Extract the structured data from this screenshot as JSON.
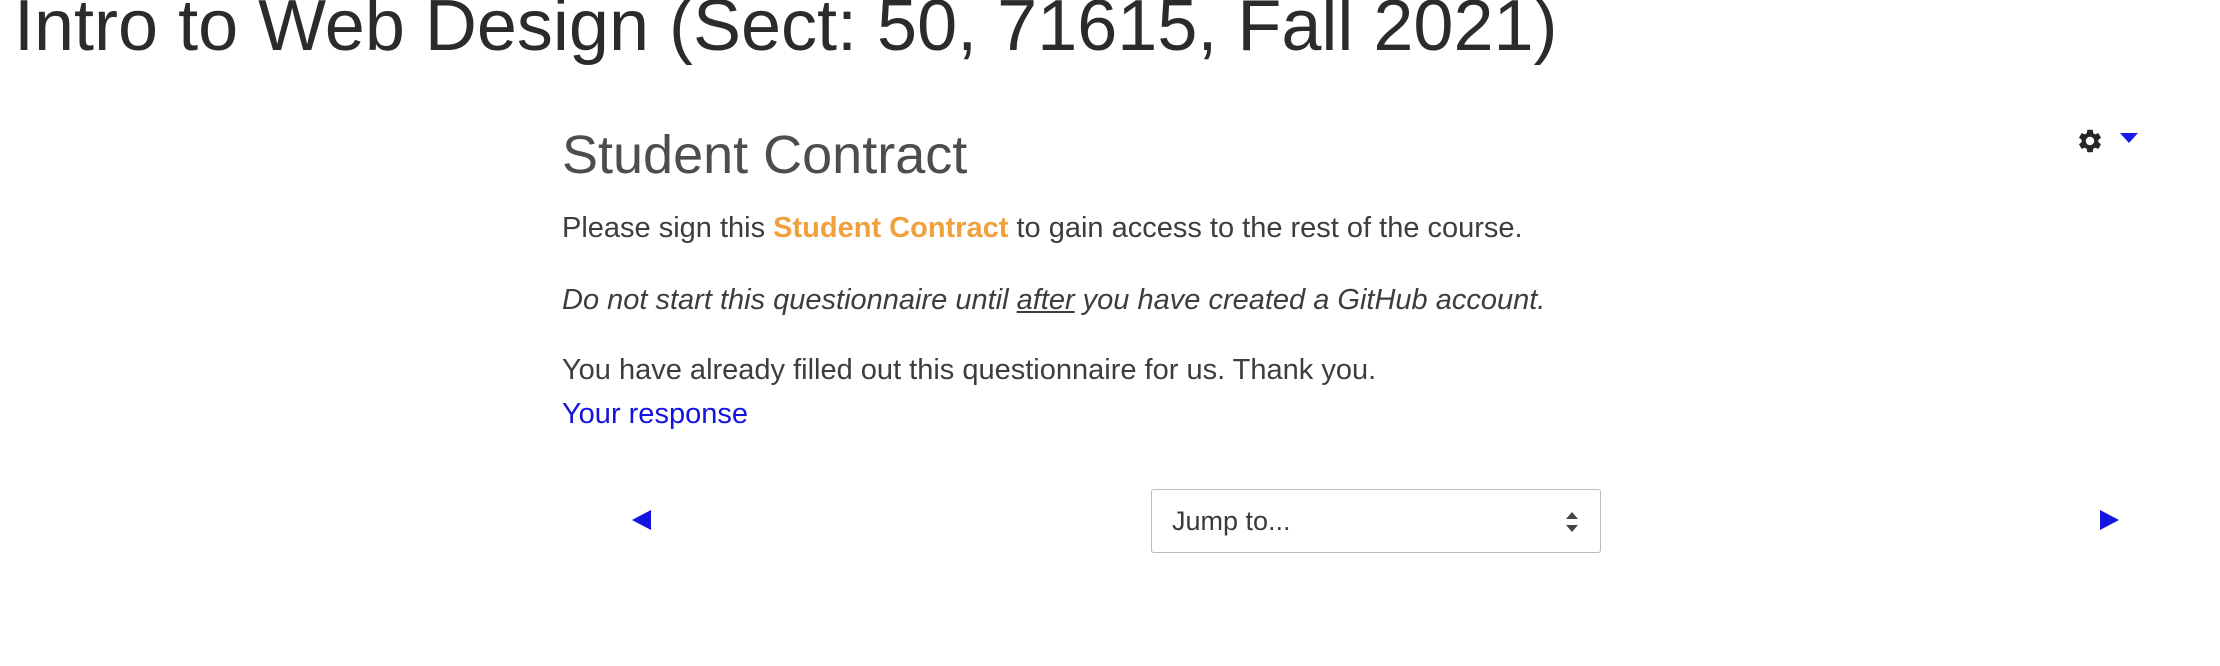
{
  "course": {
    "title": "Intro to Web Design (Sect: 50, 71615, Fall 2021)"
  },
  "activity": {
    "title": "Student Contract",
    "intro_prefix": "Please sign this ",
    "intro_link": "Student Contract",
    "intro_suffix": " to gain access to the rest of the course.",
    "note_prefix": "Do not start this questionnaire until ",
    "note_emphasis": "after",
    "note_suffix": " you have created a GitHub account.",
    "completed_message": "You have already filled out this questionnaire for us. Thank you.",
    "response_link": "Your response"
  },
  "actions_menu": {
    "icon": "gear-icon",
    "dropdown_icon": "caret-down-icon"
  },
  "navigation": {
    "prev_icon": "triangle-left-icon",
    "next_icon": "triangle-right-icon",
    "jump_to_label": "Jump to..."
  },
  "colors": {
    "link": "#1414e0",
    "highlight_link": "#f0a03c",
    "text": "#3d3d3d"
  }
}
